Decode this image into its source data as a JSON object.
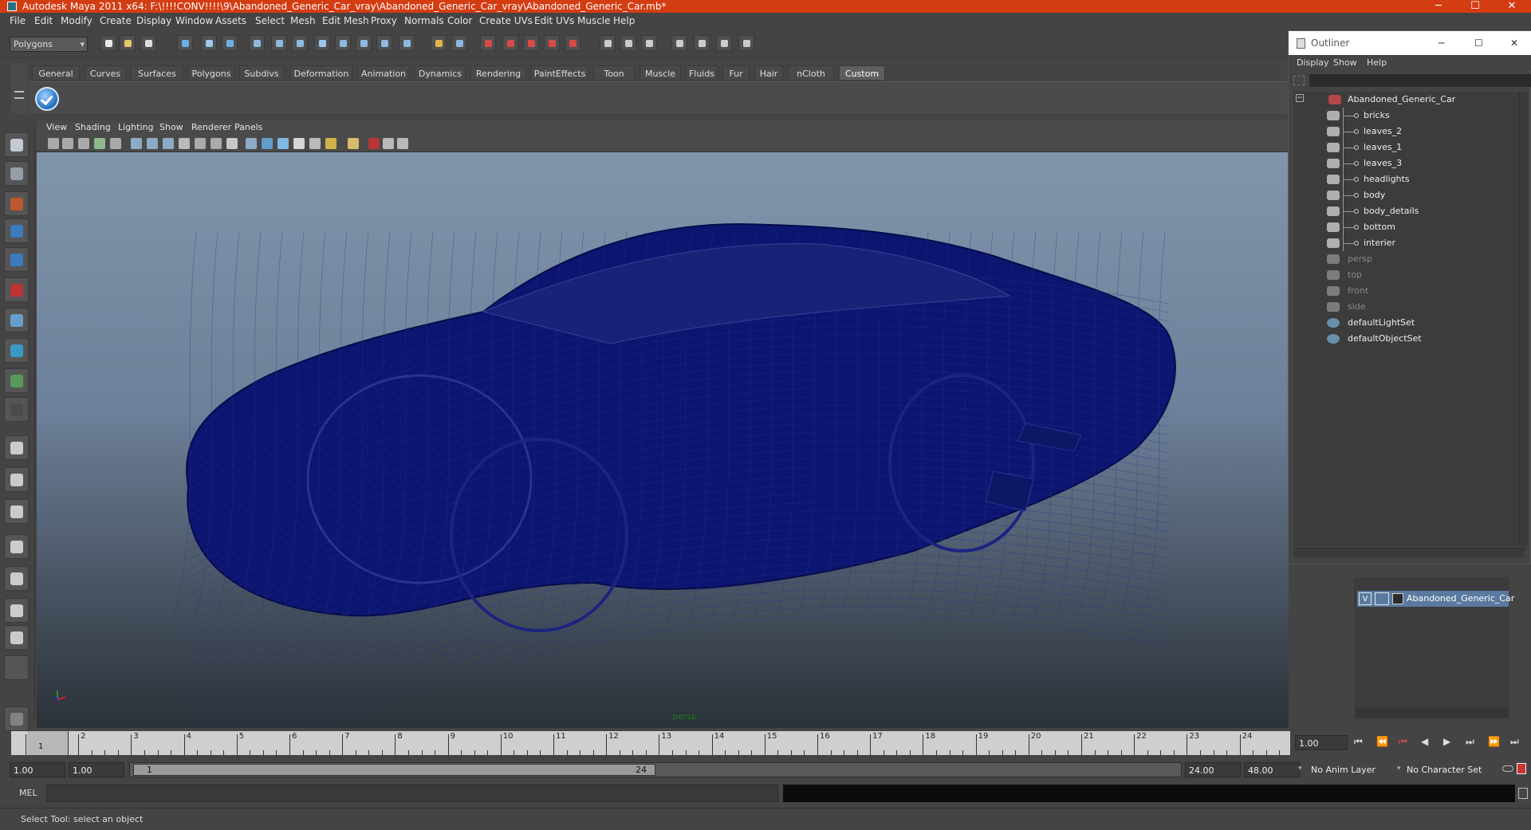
{
  "window": {
    "title": "Autodesk Maya 2011 x64: F:\\!!!!CONV!!!!\\9\\Abandoned_Generic_Car_vray\\Abandoned_Generic_Car_vray\\Abandoned_Generic_Car.mb*",
    "minimize": "─",
    "maximize": "☐",
    "close": "✕"
  },
  "menubar": [
    "File",
    "Edit",
    "Modify",
    "Create",
    "Display",
    "Window",
    "Assets",
    "Select",
    "Mesh",
    "Edit Mesh",
    "Proxy",
    "Normals",
    "Color",
    "Create UVs",
    "Edit UVs",
    "Muscle",
    "Help"
  ],
  "statusline": {
    "mode": "Polygons"
  },
  "shelf": {
    "tabs": [
      "General",
      "Curves",
      "Surfaces",
      "Polygons",
      "Subdivs",
      "Deformation",
      "Animation",
      "Dynamics",
      "Rendering",
      "PaintEffects",
      "Toon",
      "Muscle",
      "Fluids",
      "Fur",
      "Hair",
      "nCloth",
      "Custom"
    ],
    "active": "Custom"
  },
  "panel": {
    "menus": [
      "View",
      "Shading",
      "Lighting",
      "Show",
      "Renderer",
      "Panels"
    ],
    "camera_label": "persp"
  },
  "outliner": {
    "title": "Outliner",
    "menus": [
      "Display",
      "Show",
      "Help"
    ],
    "items": [
      {
        "label": "Abandoned_Generic_Car",
        "level": 0,
        "dim": false
      },
      {
        "label": "bricks",
        "level": 1,
        "dim": false
      },
      {
        "label": "leaves_2",
        "level": 1,
        "dim": false
      },
      {
        "label": "leaves_1",
        "level": 1,
        "dim": false
      },
      {
        "label": "leaves_3",
        "level": 1,
        "dim": false
      },
      {
        "label": "headlights",
        "level": 1,
        "dim": false
      },
      {
        "label": "body",
        "level": 1,
        "dim": false
      },
      {
        "label": "body_details",
        "level": 1,
        "dim": false
      },
      {
        "label": "bottom",
        "level": 1,
        "dim": false
      },
      {
        "label": "interier",
        "level": 1,
        "dim": false
      },
      {
        "label": "persp",
        "level": 0,
        "dim": true
      },
      {
        "label": "top",
        "level": 0,
        "dim": true
      },
      {
        "label": "front",
        "level": 0,
        "dim": true
      },
      {
        "label": "side",
        "level": 0,
        "dim": true
      },
      {
        "label": "defaultLightSet",
        "level": 0,
        "dim": false
      },
      {
        "label": "defaultObjectSet",
        "level": 0,
        "dim": false
      }
    ]
  },
  "layers": {
    "row": {
      "visible": "V",
      "name": "Abandoned_Generic_Car"
    }
  },
  "timeslider": {
    "frames": [
      "1",
      "2",
      "3",
      "4",
      "5",
      "6",
      "7",
      "8",
      "9",
      "10",
      "11",
      "12",
      "13",
      "14",
      "15",
      "16",
      "17",
      "18",
      "19",
      "20",
      "21",
      "22",
      "23",
      "24"
    ],
    "current_frame": "1",
    "current_time": "1.00"
  },
  "range": {
    "start": "1.00",
    "inner_start": "1.00",
    "slider_start": "1",
    "slider_end": "24",
    "end": "24.00",
    "total_end": "48.00",
    "anim_layer": "No Anim Layer",
    "character_set": "No Character Set"
  },
  "command": {
    "lang": "MEL"
  },
  "help": {
    "text": "Select Tool: select an object"
  },
  "colors": {
    "wireframe": "#0c1570",
    "titlebar": "#d43c12",
    "active_layer": "#5a7aa0"
  }
}
